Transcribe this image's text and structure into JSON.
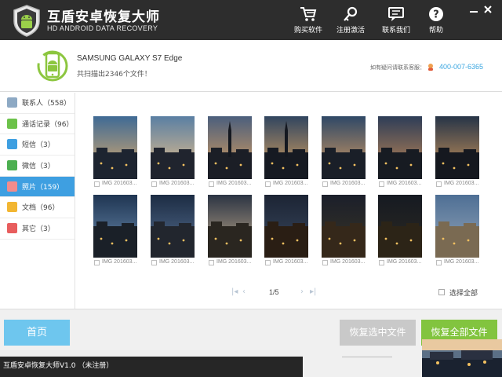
{
  "app": {
    "title": "互盾安卓恢复大师",
    "subtitle": "HD ANDROID DATA RECOVERY"
  },
  "toolbar": {
    "items": [
      {
        "label": "购买软件",
        "icon": "cart-icon"
      },
      {
        "label": "注册激活",
        "icon": "key-icon"
      },
      {
        "label": "联系我们",
        "icon": "chat-icon"
      },
      {
        "label": "帮助",
        "icon": "help-icon"
      }
    ]
  },
  "device": {
    "name": "SAMSUNG  GALAXY S7 Edge",
    "scan_info": "共扫描出2346个文件！",
    "contact_label": "如有疑问请联系客服：",
    "contact_phone": "400-007-6365"
  },
  "sidebar": {
    "items": [
      {
        "label": "联系人（558）",
        "icon": "contacts-icon",
        "color": "#8da9c4",
        "active": false
      },
      {
        "label": "通话记录（96）",
        "icon": "call-log-icon",
        "color": "#6cc24a",
        "active": false
      },
      {
        "label": "短信（3）",
        "icon": "sms-icon",
        "color": "#3e9fe1",
        "active": false
      },
      {
        "label": "微信（3）",
        "icon": "wechat-icon",
        "color": "#4caf50",
        "active": false
      },
      {
        "label": "照片（159）",
        "icon": "photo-icon",
        "color": "#f28c8c",
        "active": true
      },
      {
        "label": "文档（96）",
        "icon": "document-icon",
        "color": "#f2b632",
        "active": false
      },
      {
        "label": "其它（3）",
        "icon": "other-icon",
        "color": "#e85d5d",
        "active": false
      }
    ]
  },
  "photos": {
    "items": [
      {
        "name": "IMG 201603..."
      },
      {
        "name": "IMG 201603..."
      },
      {
        "name": "IMG 201603..."
      },
      {
        "name": "IMG 201603..."
      },
      {
        "name": "IMG 201603..."
      },
      {
        "name": "IMG 201603..."
      },
      {
        "name": "IMG 201603..."
      },
      {
        "name": "IMG 201603..."
      },
      {
        "name": "IMG 201603..."
      },
      {
        "name": "IMG 201603..."
      },
      {
        "name": "IMG 201603..."
      },
      {
        "name": "IMG 201603..."
      },
      {
        "name": "IMG 201603..."
      },
      {
        "name": "IMG 201603..."
      }
    ]
  },
  "pager": {
    "page": "1/5",
    "select_all": "选择全部"
  },
  "footer": {
    "home": "首页",
    "recover_selected": "恢复选中文件",
    "recover_all": "恢复全部文件",
    "status": "互盾安卓恢复大师V1.0 （未注册）"
  },
  "colors": {
    "titlebar": "#2d2d2d",
    "accent": "#3e9fe1",
    "link": "#3aa6e0",
    "green": "#82c43f"
  }
}
